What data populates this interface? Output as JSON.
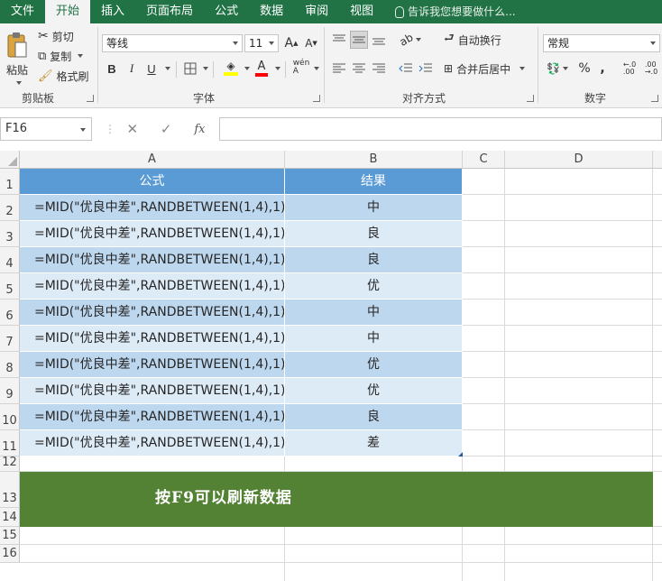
{
  "ribbon_tabs": [
    "文件",
    "开始",
    "插入",
    "页面布局",
    "公式",
    "数据",
    "审阅",
    "视图"
  ],
  "active_tab": "开始",
  "tell_me": "告诉我您想要做什么...",
  "clipboard": {
    "paste": "粘贴",
    "cut": "剪切",
    "copy": "复制",
    "format_painter": "格式刷",
    "group_label": "剪贴板"
  },
  "font": {
    "name": "等线",
    "size": "11",
    "bold": "B",
    "italic": "I",
    "underline": "U",
    "font_color": "A",
    "group_label": "字体"
  },
  "alignment": {
    "wrap_text": "自动换行",
    "merge_center": "合并后居中",
    "group_label": "对齐方式"
  },
  "number": {
    "format": "常规",
    "percent": "%",
    "comma": ",",
    "group_label": "数字"
  },
  "formula_bar": {
    "name_box": "F16",
    "fx": "fx",
    "formula": ""
  },
  "columns": [
    "A",
    "B",
    "C",
    "D"
  ],
  "rows": [
    "1",
    "2",
    "3",
    "4",
    "5",
    "6",
    "7",
    "8",
    "9",
    "10",
    "11",
    "12",
    "13",
    "14",
    "15",
    "16"
  ],
  "table": {
    "headers": [
      "公式",
      "结果"
    ],
    "rows": [
      [
        "=MID(\"优良中差\",RANDBETWEEN(1,4),1)",
        "中"
      ],
      [
        "=MID(\"优良中差\",RANDBETWEEN(1,4),1)",
        "良"
      ],
      [
        "=MID(\"优良中差\",RANDBETWEEN(1,4),1)",
        "良"
      ],
      [
        "=MID(\"优良中差\",RANDBETWEEN(1,4),1)",
        "优"
      ],
      [
        "=MID(\"优良中差\",RANDBETWEEN(1,4),1)",
        "中"
      ],
      [
        "=MID(\"优良中差\",RANDBETWEEN(1,4),1)",
        "中"
      ],
      [
        "=MID(\"优良中差\",RANDBETWEEN(1,4),1)",
        "优"
      ],
      [
        "=MID(\"优良中差\",RANDBETWEEN(1,4),1)",
        "优"
      ],
      [
        "=MID(\"优良中差\",RANDBETWEEN(1,4),1)",
        "良"
      ],
      [
        "=MID(\"优良中差\",RANDBETWEEN(1,4),1)",
        "差"
      ]
    ]
  },
  "banner": "按F9可以刷新数据",
  "colors": {
    "ribbon_green": "#217346",
    "table_header": "#5b9bd5",
    "band_dark": "#bdd7ee",
    "band_light": "#ddebf7",
    "banner_green": "#548235"
  }
}
